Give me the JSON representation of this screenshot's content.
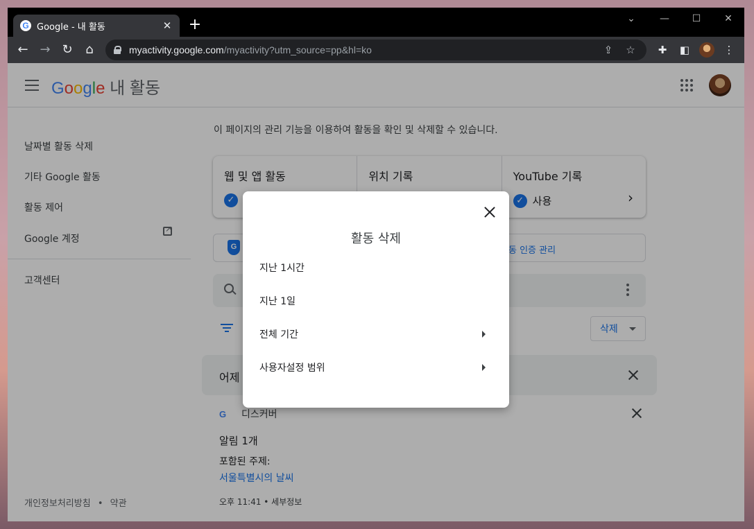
{
  "browser": {
    "tab_title": "Google - 내 활동",
    "url_host": "myactivity.google.com",
    "url_path": "/myactivity?utm_source=pp&hl=ko"
  },
  "app": {
    "logo_text": "Google",
    "product_name": "내 활동"
  },
  "sidebar": {
    "items": [
      {
        "label": "날짜별 활동 삭제"
      },
      {
        "label": "기타 Google 활동"
      },
      {
        "label": "활동 제어"
      },
      {
        "label": "Google 계정"
      },
      {
        "label": "고객센터"
      }
    ],
    "footer_privacy": "개인정보처리방침",
    "footer_separator": "•",
    "footer_terms": "약관"
  },
  "main": {
    "intro": "이 페이지의 관리 기능을 이용하여 활동을 확인 및 삭제할 수 있습니다.",
    "cards": [
      {
        "title": "웹 및 앱 활동",
        "status": ""
      },
      {
        "title": "위치 기록",
        "status": ""
      },
      {
        "title": "YouTube 기록",
        "status": "사용"
      }
    ],
    "verify_link": "동 인증 관리",
    "delete_button": "삭제",
    "day_label": "어제",
    "activity": {
      "source": "디스커버",
      "title": "알림 1개",
      "subtitle": "포함된 주제:",
      "link": "서울특별시의 날씨",
      "meta": "오후 11:41 • 세부정보"
    }
  },
  "dialog": {
    "title": "활동 삭제",
    "options": [
      {
        "label": "지난 1시간",
        "has_submenu": false
      },
      {
        "label": "지난 1일",
        "has_submenu": false
      },
      {
        "label": "전체 기간",
        "has_submenu": true
      },
      {
        "label": "사용자설정 범위",
        "has_submenu": true
      }
    ]
  },
  "colors": {
    "accent": "#1a73e8",
    "scrim": "rgba(0,0,0,0.32)"
  }
}
